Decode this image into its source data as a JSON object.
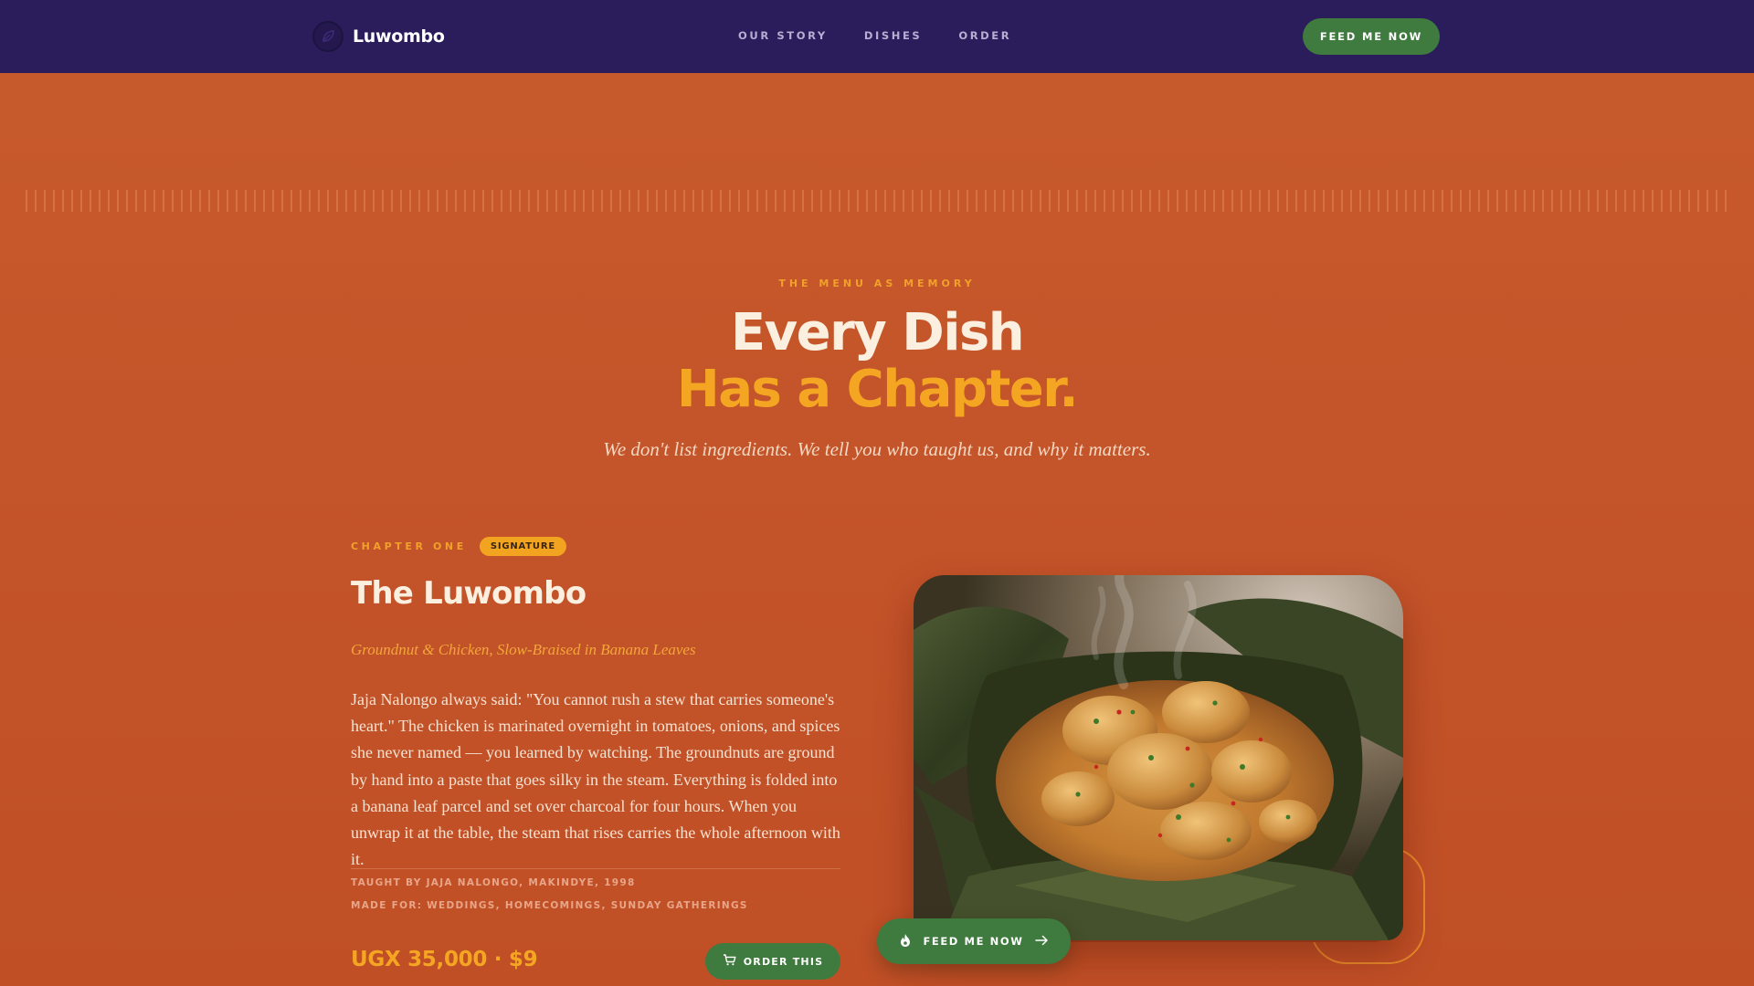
{
  "nav": {
    "brand": "Luwombo",
    "brand_icon": "leaf-logo-icon",
    "links": [
      "OUR STORY",
      "DISHES",
      "ORDER"
    ],
    "cta": "FEED ME NOW"
  },
  "hero": {
    "eyebrow": "THE MENU AS MEMORY",
    "headline_line1": "Every Dish",
    "headline_line2": "Has a Chapter.",
    "tagline": "We don't list ingredients. We tell you who taught us, and why it matters."
  },
  "chapter": {
    "label": "CHAPTER ONE",
    "badge": "SIGNATURE",
    "title": "The Luwombo",
    "subtitle": "Groundnut & Chicken, Slow-Braised in Banana Leaves",
    "story": "Jaja Nalongo always said: \"You cannot rush a stew that carries someone's heart.\" The chicken is marinated overnight in tomatoes, onions, and spices she never named — you learned by watching. The groundnuts are ground by hand into a paste that goes silky in the steam. Everything is folded into a banana leaf parcel and set over charcoal for four hours. When you unwrap it at the table, the steam that rises carries the whole afternoon with it.",
    "taught_by": "TAUGHT BY JAJA NALONGO, MAKINDYE, 1998",
    "made_for": "MADE FOR: WEDDINGS, HOMECOMINGS, SUNDAY GATHERINGS",
    "price": "UGX 35,000 · $9",
    "order_label": "ORDER THIS",
    "order_icon": "cart-icon",
    "photo_alt": "Luwombo stew in banana leaf"
  },
  "fab": {
    "label": "FEED ME NOW",
    "icon": "flame-icon",
    "arrow_icon": "arrow-right-icon"
  },
  "colors": {
    "nav_bg": "#2b1d5c",
    "page_bg": "#c85c2c",
    "accent": "#f4a623",
    "green": "#3f7a3e",
    "cream": "#fbefdf"
  }
}
